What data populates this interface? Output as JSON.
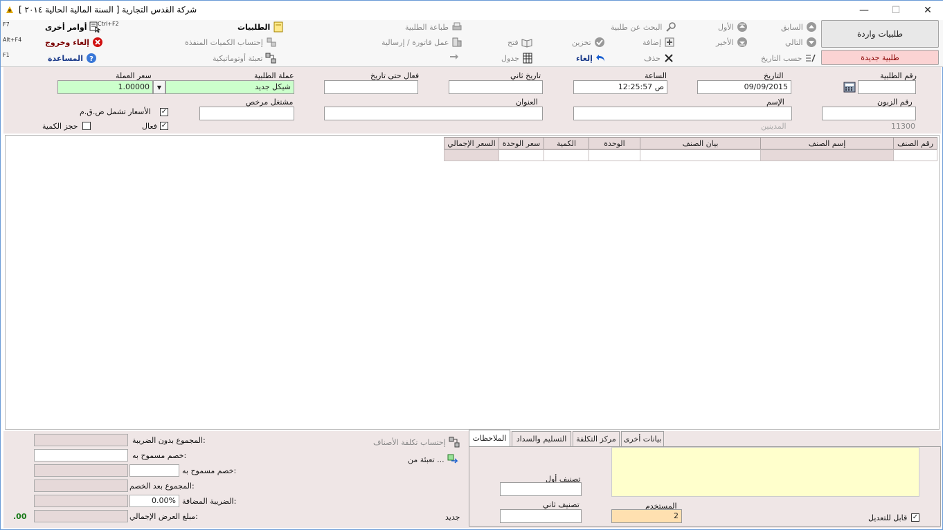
{
  "window": {
    "title": "شركة القدس التجارية [ السنة المالية الحالية ٢٠١٤ ]",
    "minimize": "—",
    "maximize": "☐",
    "close": "✕"
  },
  "toolbar": {
    "previous": "السابق",
    "first": "الأول",
    "search": "البحث عن طلبية",
    "print": "طباعة الطلبية",
    "orders": "الطلبيات",
    "other_commands": "أوامر أخرى",
    "other_shortcut": "Ctrl+F2",
    "f7": "F7",
    "next": "التالي",
    "last": "الأخير",
    "add": "إضافة",
    "save": "تخزين",
    "open": "فتح",
    "make_invoice": "عمل فاتورة / إرسالية",
    "calc_executed": "إحتساب الكميات المنفذة",
    "cancel_exit": "إلغاء وخروج",
    "altf4": "Alt+F4",
    "by_date": "حسب التاريخ",
    "delete": "حذف",
    "undo": "إلغاء",
    "table": "جدول",
    "auto_fill": "تعبئة أوتوماتيكية",
    "help": "المساعدة",
    "f1": "F1",
    "incoming_orders": "طلبيات واردة",
    "new_order": "طلبية جديدة"
  },
  "form": {
    "order_no_label": "رقم الطلبية",
    "order_no": "",
    "date_label": "التاريخ",
    "date": "09/09/2015",
    "time_label": "الساعة",
    "time": "12:25:57 ص",
    "second_date_label": "تاريخ ثاني",
    "second_date": "",
    "active_until_label": "فعال حتى تاريخ",
    "active_until": "",
    "order_currency_label": "عملة الطلبية",
    "order_currency": "شيكل جديد",
    "currency_rate_label": "سعر العملة",
    "currency_rate": "1.00000",
    "customer_no_label": "رقم الزبون",
    "customer_no": "",
    "name_label": "الإسم",
    "name": "",
    "address_label": "العنوان",
    "address": "",
    "licensed_operator_label": "مشتغل مرخص",
    "licensed_operator": "",
    "prices_include_vat": "الأسعار تشمل ض.ق.م",
    "active": "فعال",
    "reserve_qty": "حجز الكمية",
    "debtors_code": "11300",
    "debtors_label": "المدينين"
  },
  "grid": {
    "columns": [
      "رقم الصنف",
      "إسم الصنف",
      "بيان الصنف",
      "الوحدة",
      "الكمية",
      "سعر الوحدة",
      "السعر الإجمالي"
    ]
  },
  "bottom": {
    "tabs": [
      "الملاحظات",
      "التسليم والسداد",
      "مركز التكلفة",
      "بيانات أخرى"
    ],
    "first_class_label": "تصنيف أول",
    "first_class": "",
    "second_class_label": "تصنيف ثاني",
    "second_class": "",
    "user_label": "المستخدم",
    "user": "2",
    "editable": "قابل للتعديل",
    "calc_cost": "إحتساب تكلفة الأصناف",
    "fill_from": "تعبئة من ...",
    "status": "جديد",
    "subtotal_label": "المجموع بدون الضريبة:",
    "discount1_label": "خصم مسموح به:",
    "discount2_label": "خصم مسموح به:",
    "after_discount_label": "المجموع بعد الخصم:",
    "vat_label": "الضريبة المضافة:",
    "vat": "0.00%",
    "total_label": "مبلغ العرض الإجمالي:",
    "total": ".00"
  },
  "colors": {
    "accent_green": "#ccffcc",
    "new_order_bg": "#fbd3d3",
    "notes_bg": "#ffffcc",
    "user_bg": "#ffe0b0"
  }
}
